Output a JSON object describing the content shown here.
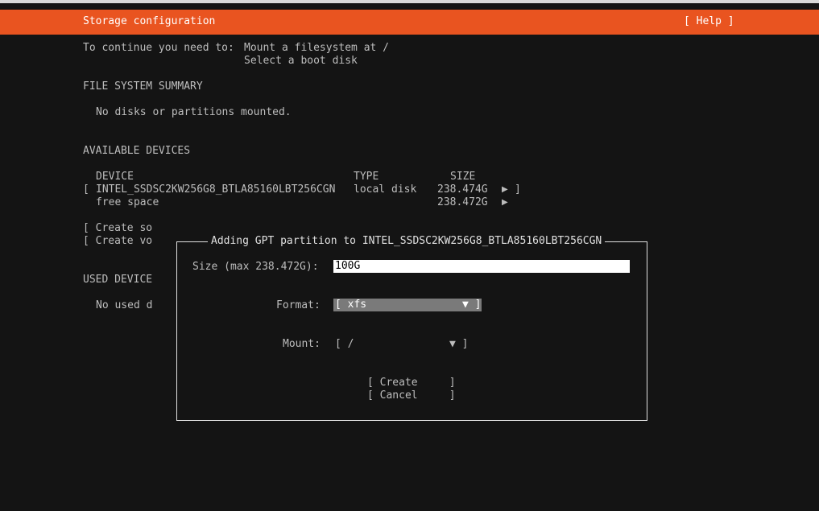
{
  "header": {
    "title": "Storage configuration",
    "help": "[ Help ]"
  },
  "requirements": {
    "prefix": "To continue you need to:",
    "items": [
      "Mount a filesystem at /",
      "Select a boot disk"
    ]
  },
  "fs_summary": {
    "heading": "FILE SYSTEM SUMMARY",
    "empty": "No disks or partitions mounted."
  },
  "available": {
    "heading": "AVAILABLE DEVICES",
    "columns": [
      "DEVICE",
      "TYPE",
      "SIZE"
    ],
    "rows": [
      {
        "bracket_open": "[",
        "device": "INTEL_SSDSC2KW256G8_BTLA85160LBT256CGN",
        "type": "local disk",
        "size": "238.474G",
        "arrow": "▶",
        "bracket_close": "]"
      },
      {
        "device": "free space",
        "type": "",
        "size": "238.472G",
        "arrow": "▶"
      }
    ],
    "actions": [
      "[ Create so",
      "[ Create vo"
    ]
  },
  "used": {
    "heading": "USED DEVICE",
    "empty": "No used d"
  },
  "dialog": {
    "title": "Adding GPT partition to INTEL_SSDSC2KW256G8_BTLA85160LBT256CGN",
    "size_label": "Size (max 238.472G):",
    "size_value": "100G",
    "format_label": "Format:",
    "format_value": "[ xfs",
    "format_arrow": "▼ ]",
    "mount_label": "Mount:",
    "mount_value": "[ /",
    "mount_arrow": "▼ ]",
    "create_label": "[ Create     ]",
    "cancel_label": "[ Cancel     ]"
  },
  "colors": {
    "accent": "#e95420",
    "background": "#141414",
    "text": "#bdbdbd"
  }
}
